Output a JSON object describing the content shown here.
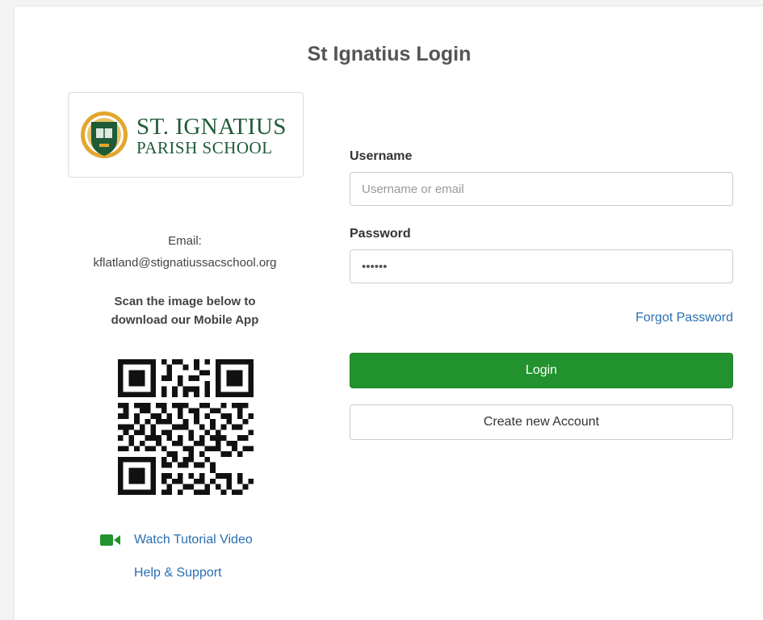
{
  "page": {
    "title": "St Ignatius Login"
  },
  "school": {
    "logo_line1": "ST. IGNATIUS",
    "logo_line2": "PARISH SCHOOL",
    "email_label": "Email:",
    "email": "kflatland@stignatiussacschool.org",
    "scan_text_1": "Scan the image below to",
    "scan_text_2": "download our Mobile App",
    "tutorial_link": "Watch Tutorial Video",
    "help_link": "Help & Support"
  },
  "form": {
    "username_label": "Username",
    "username_placeholder": "Username or email",
    "password_label": "Password",
    "password_value": "******",
    "forgot_password": "Forgot Password",
    "login_button": "Login",
    "create_account_button": "Create new Account"
  },
  "colors": {
    "login_button": "#22922e",
    "link": "#2a6fb0",
    "logo_green": "#1f5b37",
    "logo_gold": "#e2a72e",
    "video_icon": "#22922e"
  },
  "icons": {
    "crest": "school-crest-icon",
    "video": "video-camera-icon",
    "qr": "qr-code-icon"
  }
}
